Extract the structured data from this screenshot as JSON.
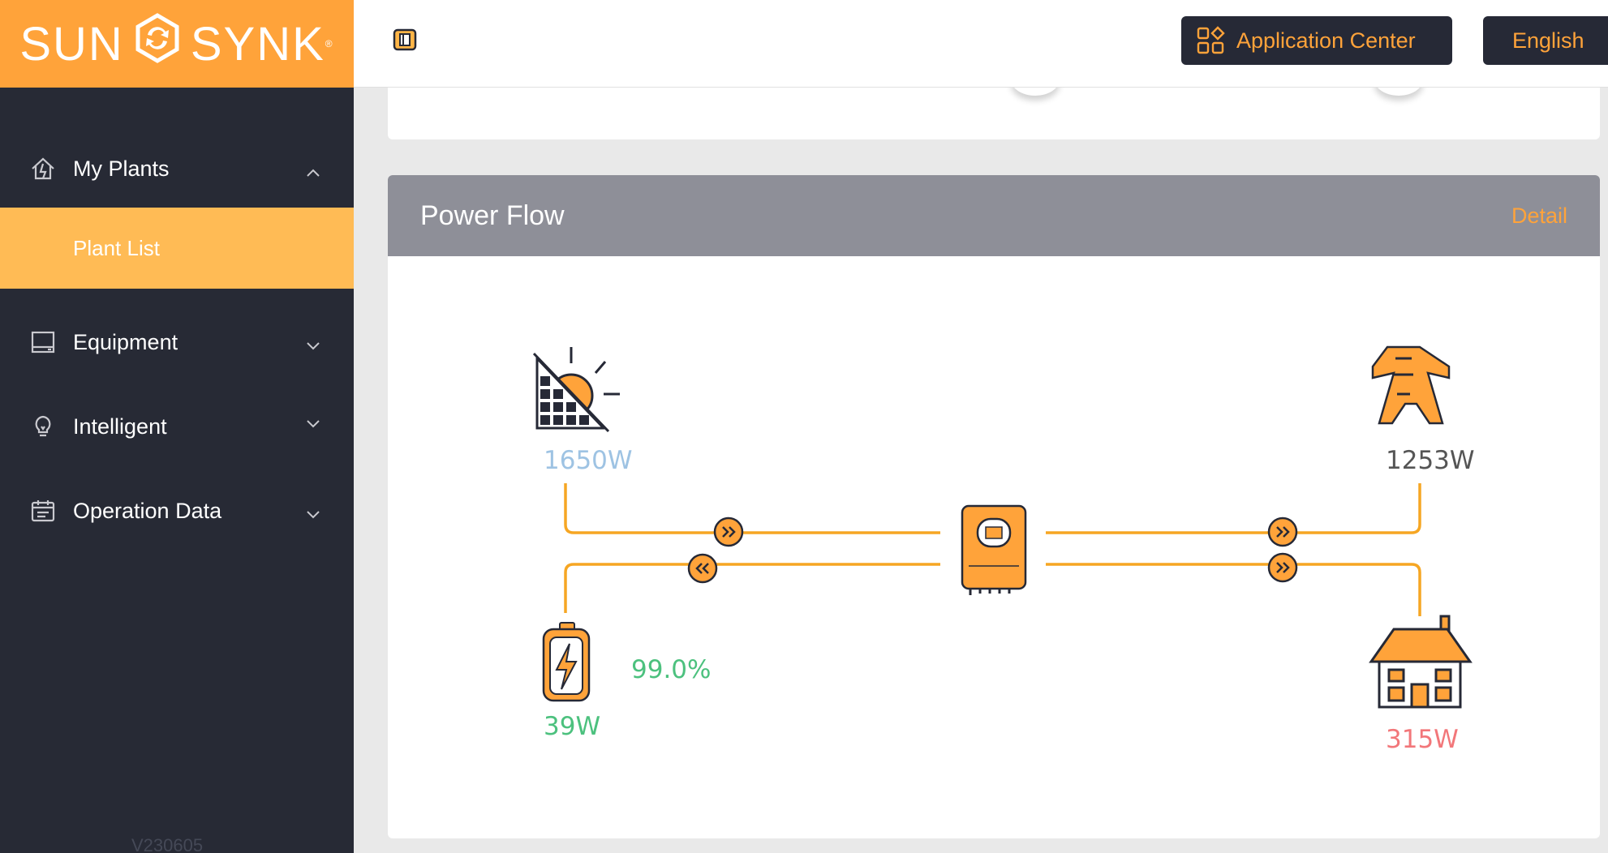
{
  "brand": {
    "left": "SUN",
    "right": "SYNK",
    "registered": "®",
    "accent": "#ffa33a"
  },
  "sidebar": {
    "items": [
      {
        "label": "My Plants",
        "icon": "home-icon",
        "expanded": true
      },
      {
        "label": "Plant List",
        "icon": "",
        "selected": true
      },
      {
        "label": "Equipment",
        "icon": "monitor-icon",
        "expanded": false
      },
      {
        "label": "Intelligent",
        "icon": "lightbulb-icon",
        "expanded": false
      },
      {
        "label": "Operation Data",
        "icon": "calendar-icon",
        "expanded": false
      }
    ],
    "version": "V230605"
  },
  "header": {
    "app_center_label": "Application Center",
    "language_label": "English"
  },
  "power_flow": {
    "title": "Power Flow",
    "detail_label": "Detail",
    "solar": {
      "value": "1650W",
      "color": "#9ec3e3"
    },
    "grid": {
      "value": "1253W",
      "color": "#555555"
    },
    "battery": {
      "value": "39W",
      "soc": "99.0%",
      "color": "#4cc17e"
    },
    "load": {
      "value": "315W",
      "color": "#f2777a"
    }
  }
}
